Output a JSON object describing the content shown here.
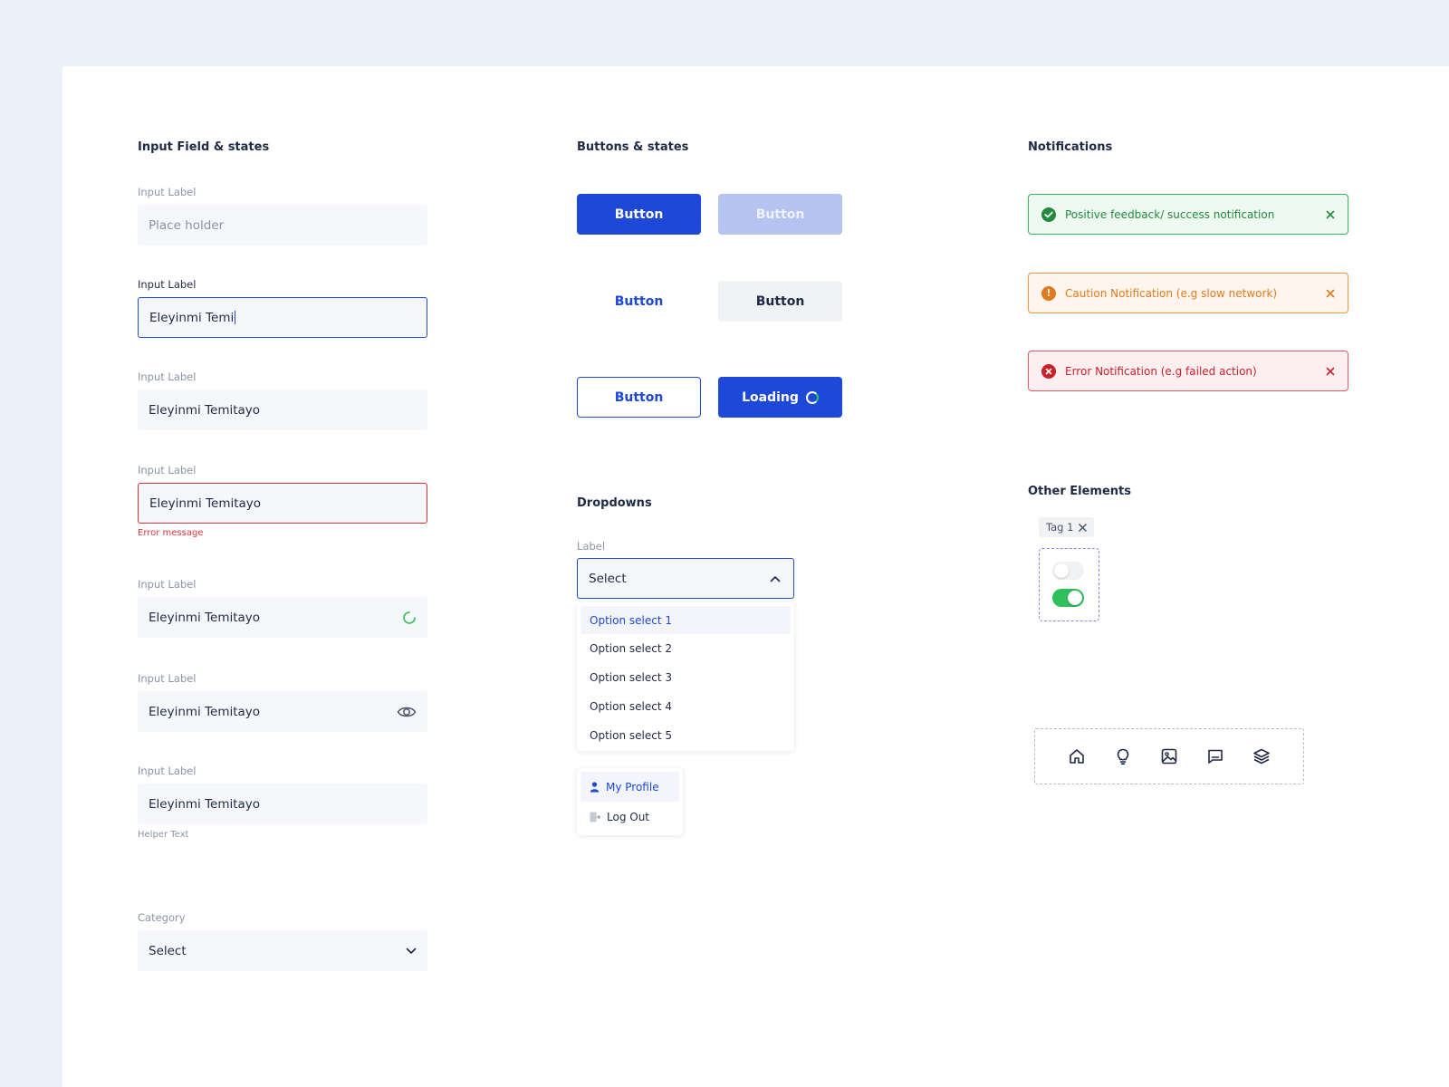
{
  "inputs": {
    "title": "Input Field & states",
    "fields": [
      {
        "label": "Input Label",
        "placeholder": "Place holder"
      },
      {
        "label": "Input Label",
        "value": "Eleyinmi Temi"
      },
      {
        "label": "Input Label",
        "value": "Eleyinmi Temitayo"
      },
      {
        "label": "Input Label",
        "value": "Eleyinmi Temitayo",
        "error": "Error message"
      },
      {
        "label": "Input Label",
        "value": "Eleyinmi Temitayo",
        "icon": "loading-spinner-icon"
      },
      {
        "label": "Input Label",
        "value": "Eleyinmi Temitayo",
        "icon": "eye-icon"
      },
      {
        "label": "Input Label",
        "value": "Eleyinmi Temitayo",
        "helper": "Helper Text"
      }
    ],
    "category": {
      "label": "Category",
      "value": "Select",
      "icon": "chevron-down-icon"
    }
  },
  "buttons": {
    "title": "Buttons & states",
    "primary": "Button",
    "disabled": "Button",
    "text": "Button",
    "secondary": "Button",
    "outline": "Button",
    "loading": "Loading"
  },
  "dropdowns": {
    "title": "Dropdowns",
    "label": "Label",
    "selected": "Select",
    "options": [
      "Option select 1",
      "Option select 2",
      "Option select 3",
      "Option select 4",
      "Option select 5"
    ],
    "profile_menu": [
      {
        "label": "My Profile",
        "icon": "user-icon"
      },
      {
        "label": "Log Out",
        "icon": "logout-icon"
      }
    ]
  },
  "notifications": {
    "title": "Notifications",
    "items": [
      {
        "type": "success",
        "text": "Positive feedback/ success notification"
      },
      {
        "type": "warning",
        "text": "Caution Notification (e.g slow network)"
      },
      {
        "type": "error",
        "text": "Error Notification (e.g failed action)"
      }
    ]
  },
  "other": {
    "title": "Other Elements",
    "tag": "Tag 1",
    "toggles": [
      false,
      true
    ],
    "icons": [
      "home-icon",
      "lightbulb-icon",
      "image-icon",
      "message-icon",
      "layers-icon"
    ]
  },
  "colors": {
    "background": "#eaf1fb",
    "primary": "#1e48d8",
    "success": "#218a3c",
    "warning": "#e17a1c",
    "error": "#e0313b",
    "toggle_on": "#2fbf5b"
  }
}
